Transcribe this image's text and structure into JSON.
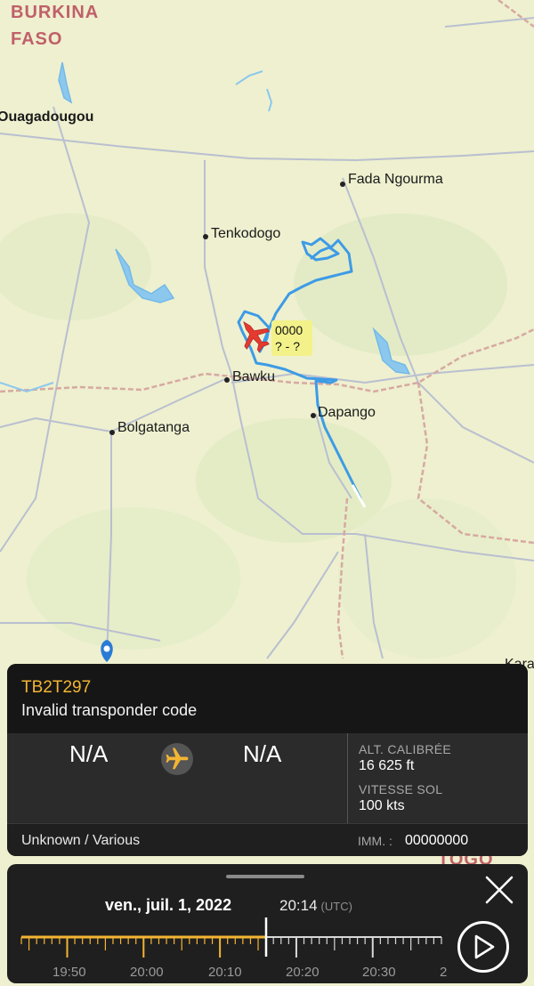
{
  "map": {
    "country_label_line1": "BURKINA",
    "country_label_line2": "FASO",
    "country_label_bottom": "TOGO",
    "cities": {
      "ouagadougou": "Ouagadougou",
      "fada": "Fada Ngourma",
      "tenkodogo": "Tenkodogo",
      "bawku": "Bawku",
      "dapango": "Dapango",
      "bolgatanga": "Bolgatanga",
      "kara": "Kara"
    },
    "track_color": "#3d9be6",
    "plane_color": "#e63a30",
    "flight_tag": {
      "squawk": "0000",
      "route": "? - ?"
    }
  },
  "flight_card": {
    "callsign": "TB2T297",
    "subtitle": "Invalid transponder code",
    "origin": "N/A",
    "destination": "N/A",
    "plane_icon": "airplane-icon",
    "altitude_label": "ALT. CALIBRÉE",
    "altitude_value": "16 625 ft",
    "speed_label": "VITESSE SOL",
    "speed_value": "100 kts",
    "aircraft": "Unknown / Various",
    "registration_label": "IMM. :",
    "registration_value": "00000000",
    "accent_color": "#f4b533"
  },
  "timeline": {
    "date": "ven., juil. 1, 2022",
    "time": "20:14",
    "timezone": "(UTC)",
    "labels": [
      "19:50",
      "20:00",
      "20:10",
      "20:20",
      "20:30",
      "2"
    ],
    "played_fraction": 0.58,
    "close_icon": "close-icon",
    "play_icon": "play-icon"
  }
}
